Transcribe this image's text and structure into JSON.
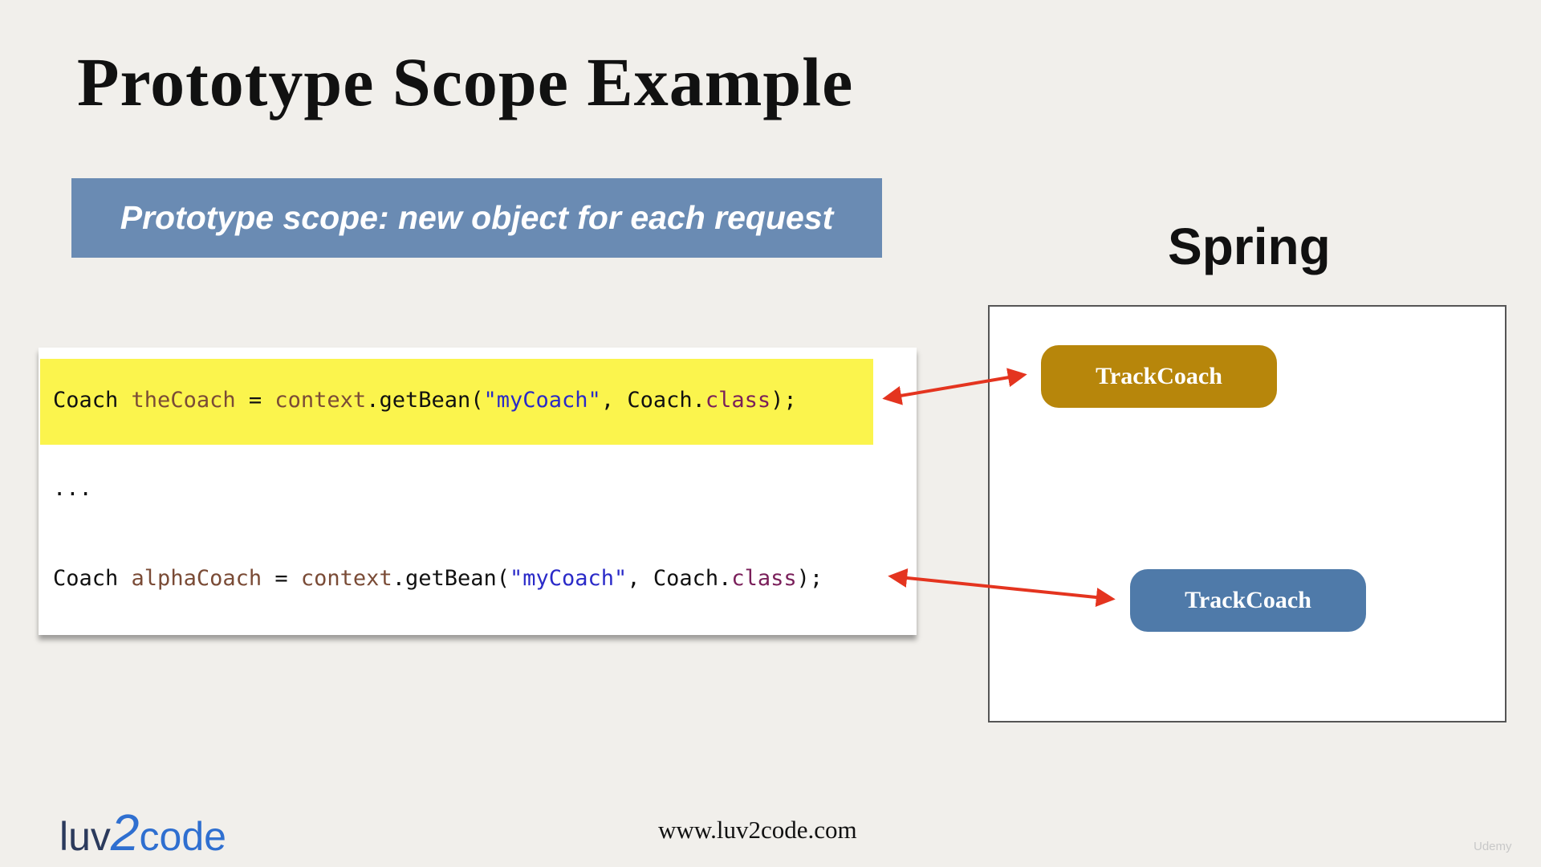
{
  "slide": {
    "title": "Prototype Scope Example",
    "banner": "Prototype scope: new object for each request"
  },
  "code": {
    "line1": {
      "type": "Coach",
      "var": "theCoach",
      "eq": "=",
      "obj": "context",
      "call": ".getBean(",
      "str": "\"myCoach\"",
      "sep": ", Coach.",
      "kw": "class",
      "end": ");"
    },
    "ellipsis": "...",
    "line2": {
      "type": "Coach",
      "var": "alphaCoach",
      "eq": "=",
      "obj": "context",
      "call": ".getBean(",
      "str": "\"myCoach\"",
      "sep": ", Coach.",
      "kw": "class",
      "end": ");"
    }
  },
  "spring": {
    "label": "Spring",
    "bean1": "TrackCoach",
    "bean2": "TrackCoach"
  },
  "footer": {
    "logo_luv": "luv",
    "logo_two": "2",
    "logo_code": "code",
    "url": "www.luv2code.com",
    "watermark": "Udemy"
  },
  "colors": {
    "banner": "#6a8bb3",
    "highlight": "#fbf44d",
    "bean1": "#b7860b",
    "bean2": "#4f7aa9",
    "arrow": "#e4341f"
  }
}
